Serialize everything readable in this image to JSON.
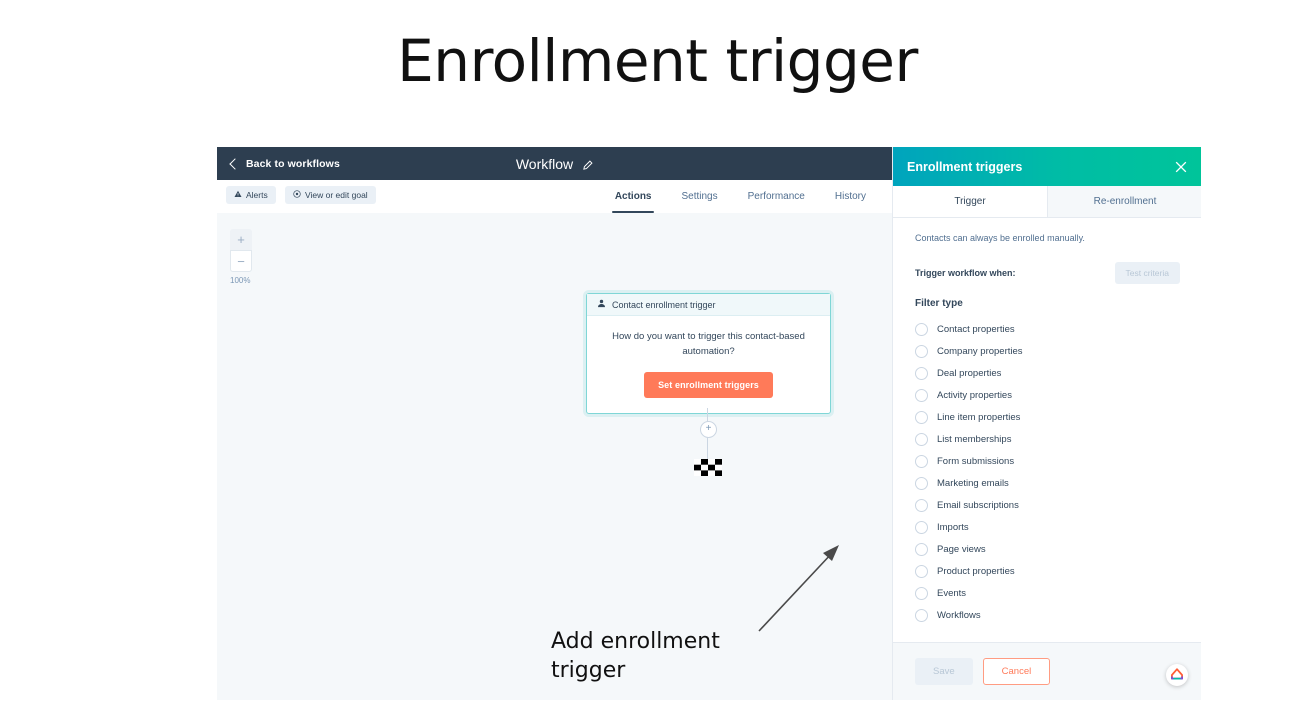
{
  "slide": {
    "title": "Enrollment trigger",
    "annotation": "Add enrollment\ntrigger",
    "annotation_line1": "Add enrollment",
    "annotation_line2": "trigger"
  },
  "colors": {
    "navy": "#2d3e50",
    "canvas_bg": "#f5f8fa",
    "accent_orange": "#ff7a59",
    "panel_gradient_start": "#00a4bd",
    "panel_gradient_end": "#00c49a",
    "card_border_teal": "#7fd6d6",
    "text_primary": "#33475b",
    "text_secondary": "#516f90"
  },
  "topbar": {
    "back_label": "Back to workflows",
    "workflow_title": "Workflow",
    "edit_icon": "pencil-icon",
    "back_icon": "chevron-left-icon"
  },
  "subbar": {
    "alerts_label": "Alerts",
    "alerts_icon": "warning-triangle-icon",
    "goal_label": "View or edit goal",
    "goal_icon": "target-icon",
    "tabs": [
      {
        "label": "Actions",
        "active": true
      },
      {
        "label": "Settings",
        "active": false
      },
      {
        "label": "Performance",
        "active": false
      },
      {
        "label": "History",
        "active": false
      }
    ]
  },
  "canvas": {
    "zoom": {
      "in_label": "+",
      "out_label": "−",
      "percent": "100%"
    },
    "card": {
      "header_label": "Contact enrollment trigger",
      "header_icon": "contact-person-icon",
      "question": "How do you want to trigger this contact-based automation?",
      "cta_label": "Set enrollment triggers"
    },
    "connector": {
      "add_node_label": "+",
      "end_icon": "checkered-flag-icon"
    }
  },
  "panel": {
    "title": "Enrollment triggers",
    "close_icon": "close-icon",
    "tabs": [
      {
        "label": "Trigger",
        "active": true
      },
      {
        "label": "Re-enrollment",
        "active": false
      }
    ],
    "note": "Contacts can always be enrolled manually.",
    "trigger_when_label": "Trigger workflow when:",
    "test_criteria_label": "Test criteria",
    "filter_type_label": "Filter type",
    "filter_options": [
      "Contact properties",
      "Company properties",
      "Deal properties",
      "Activity properties",
      "Line item properties",
      "List memberships",
      "Form submissions",
      "Marketing emails",
      "Email subscriptions",
      "Imports",
      "Page views",
      "Product properties",
      "Events",
      "Workflows"
    ],
    "footer": {
      "save_label": "Save",
      "cancel_label": "Cancel",
      "help_icon": "hubspot-help-widget-icon"
    }
  }
}
